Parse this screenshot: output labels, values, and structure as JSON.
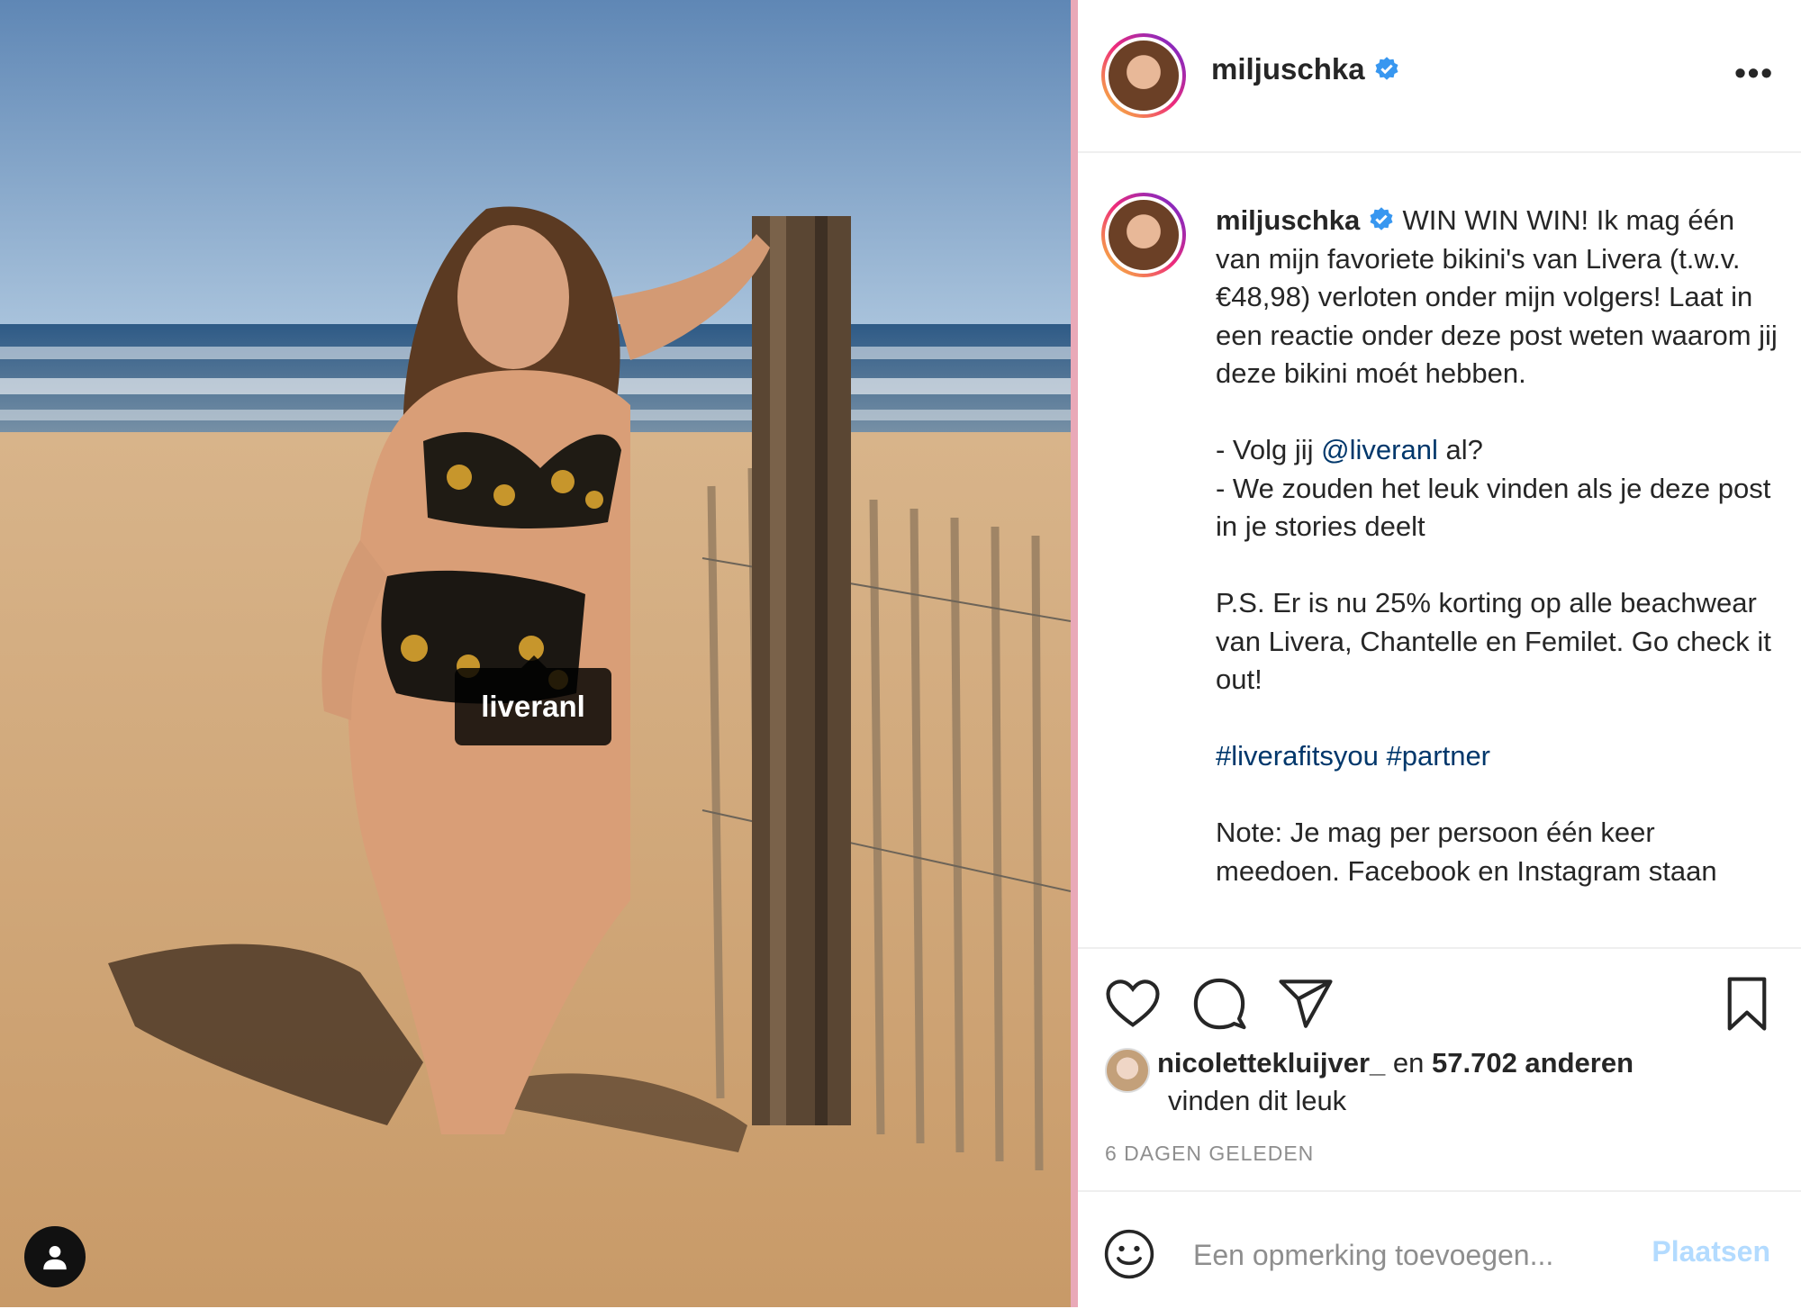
{
  "post": {
    "username": "miljuschka",
    "verified": true,
    "photo_tag": "liveranl",
    "caption": {
      "intro": "WIN WIN WIN! Ik mag één van mijn favoriete bikini's van Livera (t.w.v. €48,98) verloten onder mijn volgers! Laat in een reactie onder deze post weten waarom jij deze bikini moét hebben.",
      "line1_prefix": "- Volg jij ",
      "line1_mention": "@liveranl",
      "line1_suffix": " al?",
      "line2": "- We zouden het leuk vinden als je deze post in je stories deelt",
      "ps": "P.S. Er is nu 25% korting op alle beachwear van Livera, Chantelle en Femilet. Go check it out!",
      "hashtag1": "#liverafitsyou",
      "hashtag2": "#partner",
      "note": "Note: Je mag per persoon één keer meedoen. Facebook en Instagram staan"
    },
    "likes": {
      "liker": "nicolettekluijver_",
      "connector": " en ",
      "others": "57.702 anderen",
      "suffix": "vinden dit leuk"
    },
    "timestamp": "6 DAGEN GELEDEN",
    "comment": {
      "placeholder": "Een opmerking toevoegen...",
      "post_label": "Plaatsen"
    }
  },
  "icons": [
    "more-icon",
    "verified-icon",
    "heart-icon",
    "comment-icon",
    "share-icon",
    "bookmark-icon",
    "emoji-icon",
    "user-tag-icon"
  ],
  "colors": {
    "link": "#00376b",
    "verified": "#3897f0",
    "post_disabled": "#b3dbff",
    "muted": "#8e8e8e"
  }
}
